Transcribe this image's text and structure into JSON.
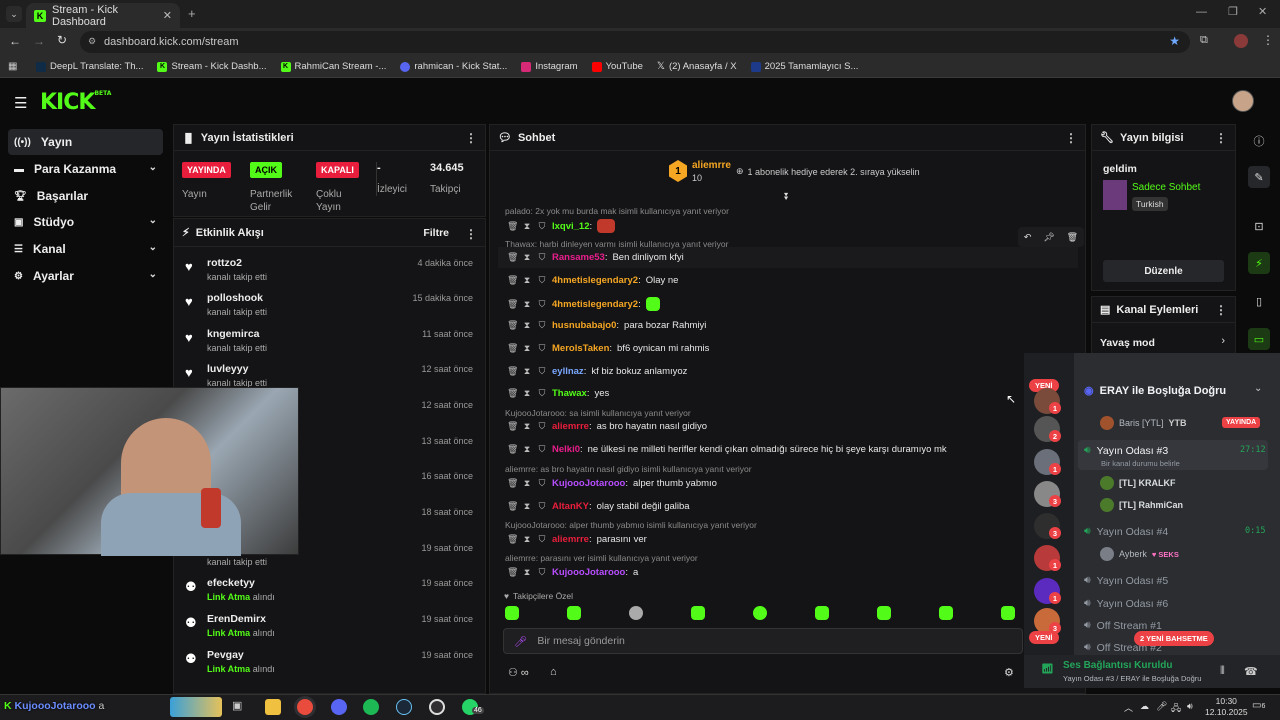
{
  "browser": {
    "tab_title": "Stream - Kick Dashboard",
    "url": "dashboard.kick.com/stream",
    "bookmarks": [
      "DeepL Translate: Th...",
      "Stream - Kick Dashb...",
      "RahmiCan Stream -...",
      "rahmican - Kick Stat...",
      "Instagram",
      "YouTube",
      "(2) Anasayfa / X",
      "2025 Tamamlayıcı S..."
    ]
  },
  "kick": {
    "logo": "KICK",
    "logo_sup": "BETA",
    "nav": [
      "Yayın",
      "Para Kazanma",
      "Başarılar",
      "Stüdyo",
      "Kanal",
      "Ayarlar"
    ]
  },
  "stats": {
    "title": "Yayın İstatistikleri",
    "items": [
      {
        "badge": "YAYINDA",
        "label": "Yayın",
        "color": "#e91e3c"
      },
      {
        "badge": "AÇIK",
        "label": "Partnerlik Gelir",
        "color": "#53fc18"
      },
      {
        "badge": "KAPALI",
        "label": "Çoklu Yayın",
        "color": "#e91e3c"
      },
      {
        "badge": "-",
        "label": "İzleyici"
      },
      {
        "badge": "34.645",
        "label": "Takipçi"
      }
    ]
  },
  "activity": {
    "title": "Etkinlik Akışı",
    "filter": "Filtre",
    "rows": [
      {
        "user": "rottzo2",
        "sub": "kanalı takip etti",
        "time": "4 dakika önce",
        "type": "follow"
      },
      {
        "user": "polloshook",
        "sub": "kanalı takip etti",
        "time": "15 dakika önce",
        "type": "follow"
      },
      {
        "user": "kngemirca",
        "sub": "kanalı takip etti",
        "time": "11 saat önce",
        "type": "follow"
      },
      {
        "user": "luvleyyy",
        "sub": "kanalı takip etti",
        "time": "12 saat önce",
        "type": "follow"
      },
      {
        "user": "",
        "sub": "",
        "time": "12 saat önce",
        "type": "follow"
      },
      {
        "user": "",
        "sub": "",
        "time": "13 saat önce",
        "type": "follow"
      },
      {
        "user": "",
        "sub": "",
        "time": "16 saat önce",
        "type": "follow"
      },
      {
        "user": "",
        "sub": "",
        "time": "18 saat önce",
        "type": "follow"
      },
      {
        "user": "",
        "sub": "kanalı takip etti",
        "time": "19 saat önce",
        "type": "follow"
      },
      {
        "user": "efecketyy",
        "sub_bold": "Link Atma",
        "sub": "alındı",
        "time": "19 saat önce",
        "type": "reward"
      },
      {
        "user": "ErenDemirx",
        "sub_bold": "Link Atma",
        "sub": "alındı",
        "time": "19 saat önce",
        "type": "reward"
      },
      {
        "user": "Pevgay",
        "sub_bold": "Link Atma",
        "sub": "alındı",
        "time": "19 saat önce",
        "type": "reward"
      }
    ]
  },
  "chat": {
    "title": "Sohbet",
    "pinned_user": "aliemrre",
    "pinned_count": "10",
    "pinned_text": "1 abonelik hediye ederek 2. sıraya yükselin",
    "follower_only": "Takipçilere Özel",
    "input_placeholder": "Bir mesaj gönderin",
    "messages": [
      {
        "reply": "palado: 2x yok mu burda mak isimli kullanıcıya yanıt veriyor",
        "user": "lxqvi_12",
        "color": "#53fc18",
        "text": ""
      },
      {
        "reply": "Thawax: harbi dinleyen varmı isimli kullanıcıya yanıt veriyor",
        "user": "Ransame53",
        "color": "#e91e8c",
        "text": "Ben dinliyom kfyi"
      },
      {
        "user": "4hmetislegendary2",
        "color": "#f5a623",
        "text": "Olay ne"
      },
      {
        "user": "4hmetislegendary2",
        "color": "#f5a623",
        "text": ""
      },
      {
        "user": "husnubabajo0",
        "color": "#f5a623",
        "text": "para bozar Rahmiyi"
      },
      {
        "user": "MerolsTaken",
        "color": "#f5a623",
        "text": "bf6 oynican mi rahmis"
      },
      {
        "user": "eyllnaz",
        "color": "#7aa7ff",
        "text": "kf biz bokuz anlamıyoz"
      },
      {
        "user": "Thawax",
        "color": "#53fc18",
        "text": "yes"
      },
      {
        "reply": "KujoooJotarooo: sa isimli kullanıcıya yanıt veriyor",
        "user": "aliemrre",
        "color": "#e91e3c",
        "text": "as bro hayatın nasıl gidiyo"
      },
      {
        "user": "Nelki0",
        "color": "#e91e8c",
        "text": "ne ülkesi ne milleti herifler kendi çıkarı olmadığı sürece hiç bi şeye karşı duramıyo mk"
      },
      {
        "reply": "aliemrre: as bro hayatın nasıl gidiyo isimli kullanıcıya yanıt veriyor",
        "user": "KujoooJotarooo",
        "color": "#b84dff",
        "text": "alper thumb yabmıo"
      },
      {
        "user": "AltanKY",
        "color": "#e91e3c",
        "text": "olay stabil değil galiba"
      },
      {
        "reply": "KujoooJotarooo: alper thumb yabmıo isimli kullanıcıya yanıt veriyor",
        "user": "aliemrre",
        "color": "#e91e3c",
        "text": "parasını ver"
      },
      {
        "reply": "aliemrre: parasını ver isimli kullanıcıya yanıt veriyor",
        "user": "KujoooJotarooo",
        "color": "#b84dff",
        "text": "a"
      }
    ]
  },
  "stream_info": {
    "title": "Yayın bilgisi",
    "stream_title": "geldim",
    "category": "Sadece Sohbet",
    "language": "Turkish",
    "edit_button": "Düzenle"
  },
  "channel_actions": {
    "title": "Kanal Eylemleri",
    "slow_mode": "Yavaş mod"
  },
  "discord": {
    "server": "ERAY ile Boşluğa Doğru",
    "new_badge": "YENİ",
    "live_user": "Baris [YTL]",
    "live_tag": "YTB",
    "live_badge": "YAYINDA",
    "channel3": "Yayın Odası #3",
    "channel3_time": "27:12",
    "channel3_status": "Bir kanal durumu belirle",
    "users3": [
      "[TL] KRALKF",
      "[TL] RahmiCan"
    ],
    "channel4": "Yayın Odası #4",
    "channel4_time": "0:15",
    "user4": "Ayberk",
    "user4_tag": "SEKS",
    "channel5": "Yayın Odası #5",
    "channel6": "Yayın Odası #6",
    "offstream1": "Off Stream #1",
    "offstream2": "Off Stream #2",
    "mentions": "2 YENİ BAHSETME",
    "voice_status": "Ses Bağlantısı Kuruldu",
    "voice_sub": "Yayın Odası #3 / ERAY ile Boşluğa Doğru",
    "server_badges": [
      "1",
      "2",
      "1",
      "3",
      "3",
      "1",
      "1",
      "3"
    ]
  },
  "taskbar": {
    "overlay_name": "KujoooJotarooo",
    "overlay_msg": "a",
    "time": "10:30",
    "date": "12.10.2025",
    "whatsapp_badge": "46",
    "notif_badge": "6"
  }
}
